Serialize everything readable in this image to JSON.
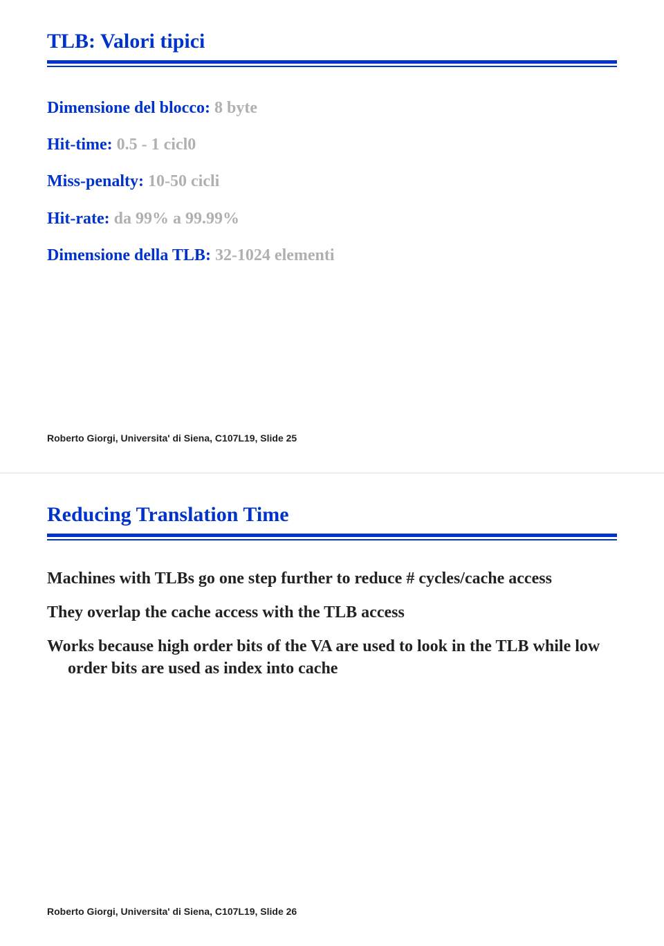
{
  "slide1": {
    "title": "TLB: Valori tipici",
    "items": [
      {
        "key": "Dimensione del blocco",
        "val": "8 byte"
      },
      {
        "key": "Hit-time",
        "val": "0.5 - 1 cicl0"
      },
      {
        "key": "Miss-penalty",
        "val": "10-50 cicli"
      },
      {
        "key": "Hit-rate",
        "val": "da 99% a 99.99%"
      },
      {
        "key": "Dimensione della TLB",
        "val": "32-1024 elementi"
      }
    ],
    "footer": "Roberto Giorgi, Universita' di Siena, C107L19,  Slide 25"
  },
  "slide2": {
    "title": "Reducing Translation Time",
    "paras": [
      "Machines with TLBs go one step further to reduce # cycles/cache access",
      "They overlap the cache access with the TLB access",
      "Works because high order bits of the VA are used to look in the TLB while low order bits are used as index into cache"
    ],
    "footer": "Roberto Giorgi, Universita' di Siena, C107L19,  Slide 26"
  }
}
